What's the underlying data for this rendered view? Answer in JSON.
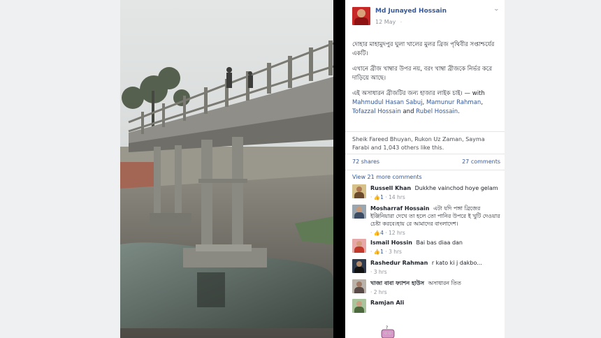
{
  "post": {
    "author": "Md Junayed Hossain",
    "date": "12 May",
    "privacy_glyph": "·",
    "paragraph1": "দোহার মাহামুদপুর ঘুলা খালের মুলর ব্রিজ পৃথিবীর সপ্তাশ্চর্যের একটি।",
    "paragraph2": "এখানে ব্রীজ খাম্বার উপর নয়, বরং খাম্বা ব্রীজকে নির্ভর করে দাড়িয়ে আছে।",
    "paragraph3": "এই অসাধারন ব্রীজটির জন্য হাজার লাইক চাই।",
    "with_text": "— with",
    "tagged": [
      "Mahmudul Hasan Sabuj",
      "Mamunur Rahman",
      "Tofazzal Hossain",
      "Rubel Hossain"
    ],
    "and_text": "and",
    "likes_text": "Sheik Fareed Bhuyan, Rukon Uz Zaman, Sayma Farabi and 1,043 others like this.",
    "shares": "72 shares",
    "comments_count": "27 comments",
    "more_comments": "View 21 more comments"
  },
  "comments": [
    {
      "name": "Russell Khan",
      "text": "Dukkhe vainchod hoye gelam",
      "likes": "1",
      "time": "14 hrs"
    },
    {
      "name": "Mosharraf Hossain",
      "text": "এটা যদি পঙ্গা ব্রিজের ইঞ্জিনিয়ারা দেখে তা হলে তো পানির উপরে ই খুটি দেওয়ার চেষ্টা করবে।হায় রে আমাদের বাংলাদেশ।",
      "likes": "4",
      "time": "12 hrs"
    },
    {
      "name": "Ismail Hossin",
      "text": "Bai bas diaa dan",
      "likes": "1",
      "time": "3 hrs"
    },
    {
      "name": "Rashedur Rahman",
      "text": "r kato ki j dakbo...",
      "likes": "",
      "time": "3 hrs"
    },
    {
      "name": "খাজা বাবা ফ্যাশন হাউস",
      "text": "অসাধারন তিত",
      "likes": "",
      "time": "2 hrs"
    },
    {
      "name": "Ramjan Ali",
      "text": "",
      "likes": "",
      "time": ""
    }
  ],
  "icons": {
    "like": "thumbs-up-icon",
    "chevron": "chevron-down-icon"
  },
  "colors": {
    "link": "#365899",
    "meta": "#90949c",
    "viewer_bg": "#000000"
  }
}
